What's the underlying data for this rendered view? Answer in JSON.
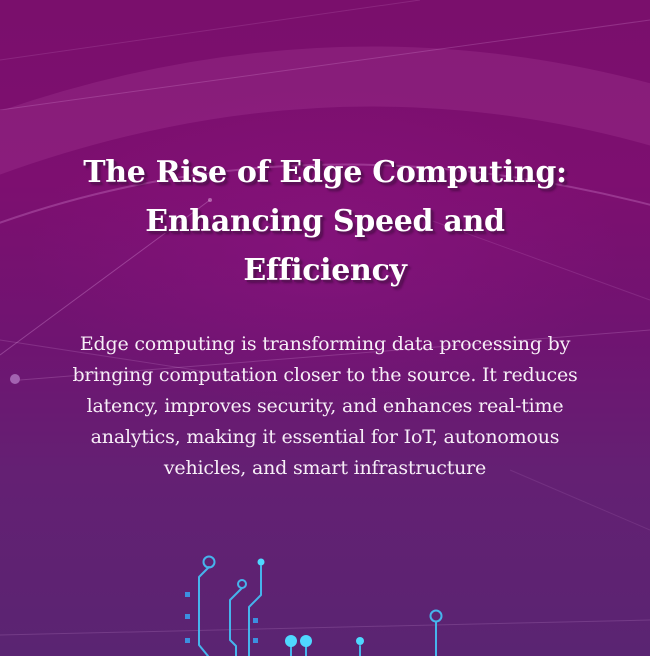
{
  "headline": {
    "line1": "The Rise of Edge Computing:",
    "line2": "Enhancing Speed and",
    "line3": "Efficiency"
  },
  "body": {
    "text": "Edge computing is transforming data processing by bringing computation closer to the source. It reduces latency, improves security, and enhances real-time analytics, making it essential for IoT, autonomous vehicles, and smart infrastructure"
  },
  "colors": {
    "background_top": "#7a0f6c",
    "background_bottom": "#5a2472",
    "text": "#ffffff",
    "circuit_accent": "#46c8ff"
  },
  "decor": {
    "background_lines": "network-lines",
    "bottom_graphic": "circuit-board-icon"
  }
}
